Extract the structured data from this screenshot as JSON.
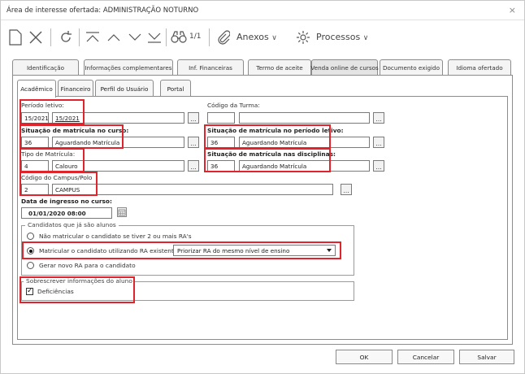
{
  "window": {
    "title": "Área de interesse ofertada: ADMINISTRAÇÃO NOTURNO",
    "close_glyph": "×"
  },
  "toolbar": {
    "new_icon": "document-icon",
    "delete_icon": "x-icon",
    "refresh_icon": "refresh-icon",
    "page_counter": "1/1",
    "attachments_label": "Anexos",
    "processes_label": "Processos"
  },
  "outer_tabs": [
    "Identificação",
    "Informações complementares",
    "Inf. Financeiras",
    "Termo de aceite",
    "Venda online de cursos",
    "Documento exigido",
    "Idioma ofertado"
  ],
  "inner_tabs": [
    "Acadêmico",
    "Financeiro",
    "Perfil do Usuário",
    "Portal"
  ],
  "form": {
    "periodo_letivo": {
      "label": "Período letivo:",
      "code": "15/2021",
      "desc": "15/2021"
    },
    "codigo_turma": {
      "label": "Código da Turma:",
      "code": "",
      "desc": ""
    },
    "sit_curso": {
      "label": "Situação de matrícula no curso:",
      "code": "36",
      "desc": "Aguardando Matrícula"
    },
    "sit_periodo": {
      "label": "Situação de matrícula no período letivo:",
      "code": "36",
      "desc": "Aguardando Matrícula"
    },
    "tipo_matricula": {
      "label": "Tipo de Matrícula:",
      "code": "4",
      "desc": "Calouro"
    },
    "sit_disciplinas": {
      "label": "Situação de matrícula nas disciplinas:",
      "code": "36",
      "desc": "Aguardando Matrícula"
    },
    "campus": {
      "label": "Código do Campus/Polo",
      "code": "2",
      "desc": "CAMPUS"
    },
    "ingresso": {
      "label": "Data de ingresso no curso:",
      "value": "01/01/2020 08:00"
    },
    "dots": "..."
  },
  "candidatos": {
    "title": "Candidatos que já são alunos",
    "opt1": "Não matricular o candidato se tiver 2 ou mais RA's",
    "opt2": "Matricular o candidato utilizando RA existente",
    "opt2_select": "Priorizar RA do mesmo nível de ensino",
    "opt3": "Gerar novo RA para o candidato",
    "selected": "opt2"
  },
  "sobrescrever": {
    "title": "Sobrescrever informações do aluno",
    "deficiencias": "Deficiências",
    "checked": true
  },
  "buttons": {
    "ok": "OK",
    "cancel": "Cancelar",
    "save": "Salvar"
  },
  "colors": {
    "highlight": "#e0242b",
    "border": "#8c8c8c"
  }
}
